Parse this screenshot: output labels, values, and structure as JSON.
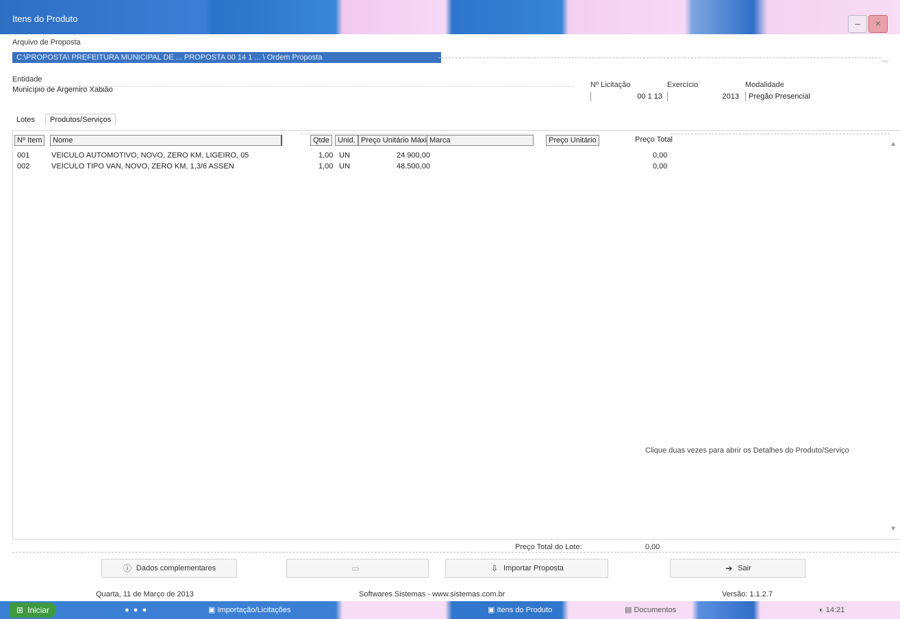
{
  "window": {
    "title": "Itens do Produto"
  },
  "proposal": {
    "label": "Arquivo de Proposta",
    "path": "C:\\PROPOSTA\\ PREFEITURA MUNICIPAL DE ... PROPOSTA 00 14 1 ... \\ Ordem Proposta"
  },
  "entity": {
    "label": "Entidade",
    "value": "Município de Argemiro Xabião"
  },
  "licitacao": {
    "label": "Nº Licitação",
    "value": "00 1 13"
  },
  "exercicio": {
    "label": "Exercício",
    "value": "2013"
  },
  "modalidade": {
    "label": "Modalidade",
    "value": "Pregão Presencial"
  },
  "tabs": [
    {
      "label": "Lotes"
    },
    {
      "label": "Produtos/Serviços"
    }
  ],
  "table": {
    "headers": {
      "item": "Nº Item",
      "nome": "Nome",
      "qtde": "Qtde",
      "unid": "Unid.",
      "preco_max": "Preço Unitário Máximo",
      "marca": "Marca",
      "preco_unit": "Preço Unitário",
      "preco_total": "Preço Total"
    },
    "rows": [
      {
        "item": "001",
        "nome": "VEÍCULO AUTOMOTIVO, NOVO, ZERO KM, LIGEIRO, 05",
        "qtde": "1,00",
        "unid": "UN",
        "preco_max": "24.900,00",
        "preco_total": "0,00"
      },
      {
        "item": "002",
        "nome": "VEÍCULO TIPO VAN, NOVO, ZERO KM, 1,3/6 ASSEN",
        "qtde": "1,00",
        "unid": "UN",
        "preco_max": "48.500,00",
        "preco_total": "0,00"
      }
    ]
  },
  "hint": "Clique duas vezes para abrir os Detalhes do Produto/Serviço",
  "totals": {
    "label": "Preço Total do Lote:",
    "value": "0,00"
  },
  "buttons": {
    "dados": "Dados complementares",
    "blank": "",
    "importar": "Importar Proposta",
    "sair": "Sair"
  },
  "status": {
    "date": "Quarta, 11 de Março de 2013",
    "company": "Softwares Sistemas - www.sistemas.com.br",
    "version": "Versão: 1.1.2.7"
  },
  "taskbar": {
    "start": "Iniciar",
    "item1": "Importação/Licitações",
    "item2": "Itens do Produto",
    "item3": "Documentos",
    "clock": "14:21"
  }
}
